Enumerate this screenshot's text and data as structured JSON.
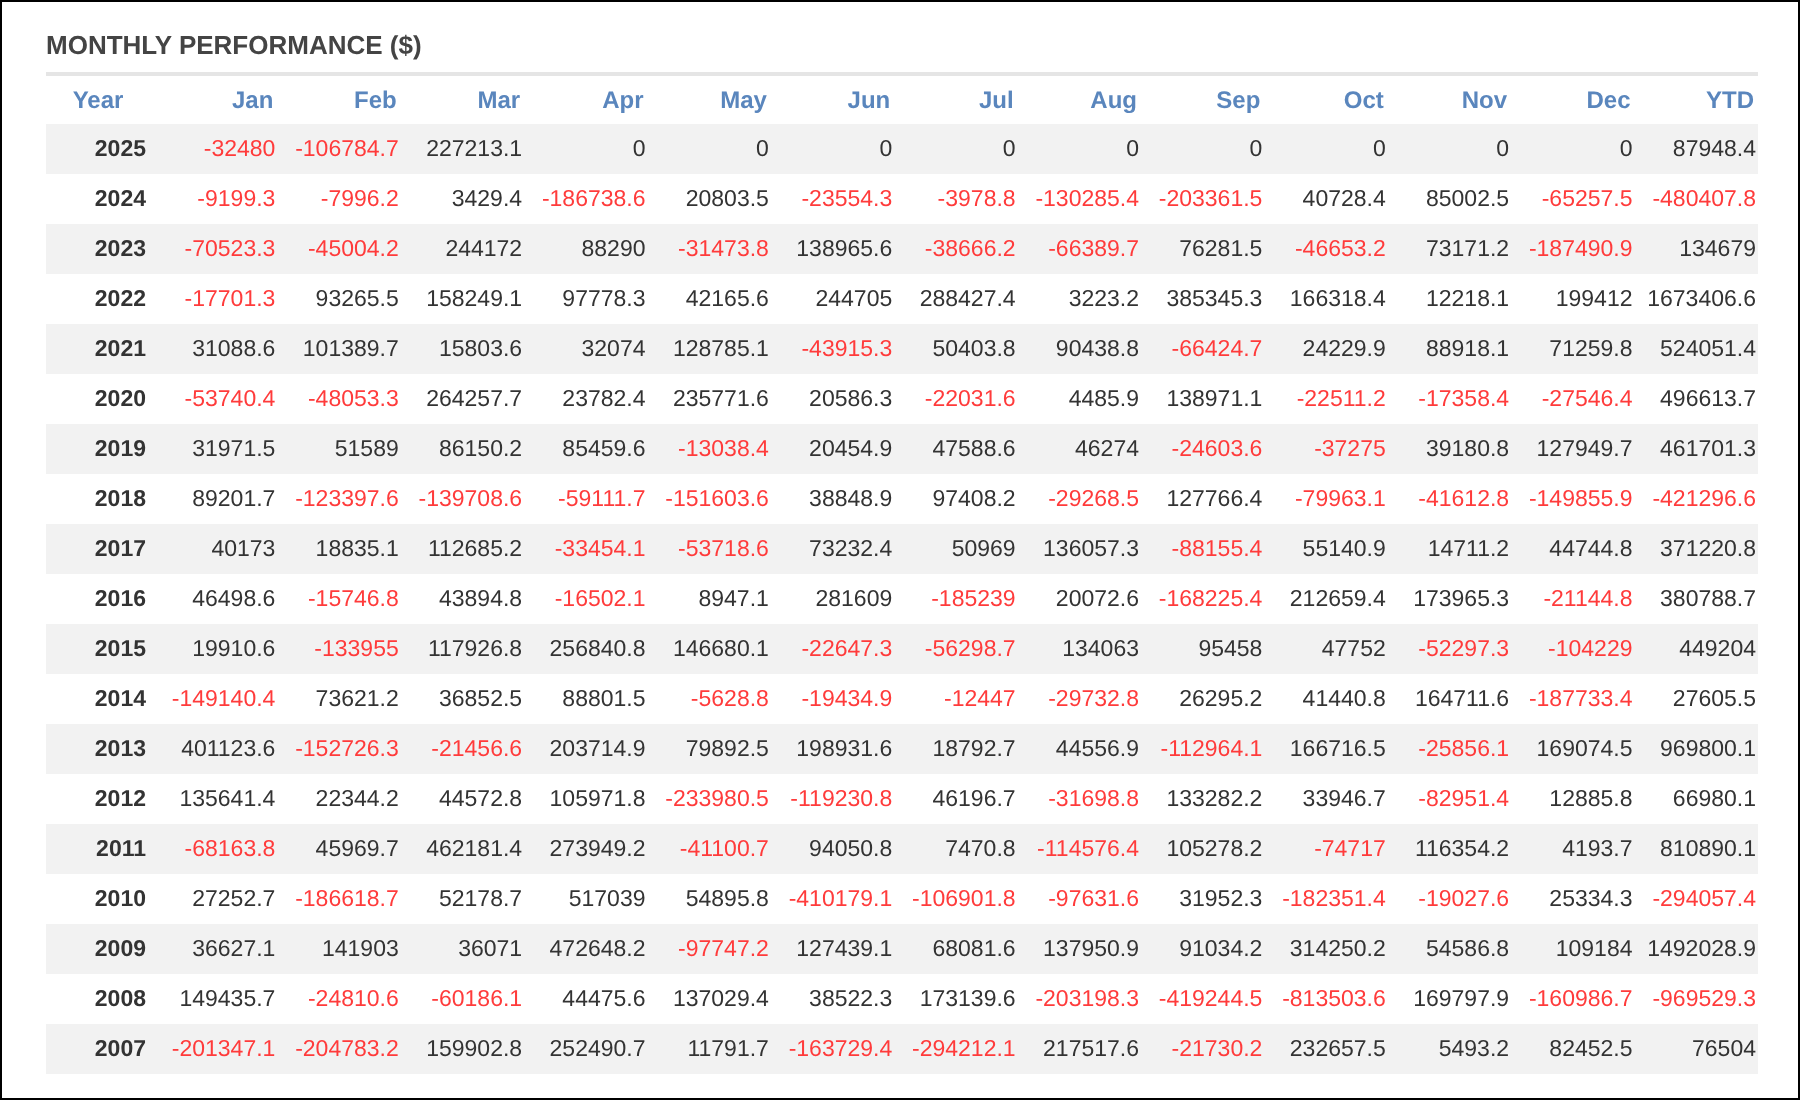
{
  "title": "MONTHLY PERFORMANCE ($)",
  "columns": [
    "Year",
    "Jan",
    "Feb",
    "Mar",
    "Apr",
    "May",
    "Jun",
    "Jul",
    "Aug",
    "Sep",
    "Oct",
    "Nov",
    "Dec",
    "YTD"
  ],
  "rows": [
    {
      "year": "2025",
      "cells": [
        {
          "value": "-32480",
          "negative": true
        },
        {
          "value": "-106784.7",
          "negative": true
        },
        {
          "value": "227213.1",
          "negative": false
        },
        {
          "value": "0",
          "negative": false
        },
        {
          "value": "0",
          "negative": false
        },
        {
          "value": "0",
          "negative": false
        },
        {
          "value": "0",
          "negative": false
        },
        {
          "value": "0",
          "negative": false
        },
        {
          "value": "0",
          "negative": false
        },
        {
          "value": "0",
          "negative": false
        },
        {
          "value": "0",
          "negative": false
        },
        {
          "value": "0",
          "negative": false
        },
        {
          "value": "87948.4",
          "negative": false
        }
      ]
    },
    {
      "year": "2024",
      "cells": [
        {
          "value": "-9199.3",
          "negative": true
        },
        {
          "value": "-7996.2",
          "negative": true
        },
        {
          "value": "3429.4",
          "negative": false
        },
        {
          "value": "-186738.6",
          "negative": true
        },
        {
          "value": "20803.5",
          "negative": false
        },
        {
          "value": "-23554.3",
          "negative": true
        },
        {
          "value": "-3978.8",
          "negative": true
        },
        {
          "value": "-130285.4",
          "negative": true
        },
        {
          "value": "-203361.5",
          "negative": true
        },
        {
          "value": "40728.4",
          "negative": false
        },
        {
          "value": "85002.5",
          "negative": false
        },
        {
          "value": "-65257.5",
          "negative": true
        },
        {
          "value": "-480407.8",
          "negative": true
        }
      ]
    },
    {
      "year": "2023",
      "cells": [
        {
          "value": "-70523.3",
          "negative": true
        },
        {
          "value": "-45004.2",
          "negative": true
        },
        {
          "value": "244172",
          "negative": false
        },
        {
          "value": "88290",
          "negative": false
        },
        {
          "value": "-31473.8",
          "negative": true
        },
        {
          "value": "138965.6",
          "negative": false
        },
        {
          "value": "-38666.2",
          "negative": true
        },
        {
          "value": "-66389.7",
          "negative": true
        },
        {
          "value": "76281.5",
          "negative": false
        },
        {
          "value": "-46653.2",
          "negative": true
        },
        {
          "value": "73171.2",
          "negative": false
        },
        {
          "value": "-187490.9",
          "negative": true
        },
        {
          "value": "134679",
          "negative": false
        }
      ]
    },
    {
      "year": "2022",
      "cells": [
        {
          "value": "-17701.3",
          "negative": true
        },
        {
          "value": "93265.5",
          "negative": false
        },
        {
          "value": "158249.1",
          "negative": false
        },
        {
          "value": "97778.3",
          "negative": false
        },
        {
          "value": "42165.6",
          "negative": false
        },
        {
          "value": "244705",
          "negative": false
        },
        {
          "value": "288427.4",
          "negative": false
        },
        {
          "value": "3223.2",
          "negative": false
        },
        {
          "value": "385345.3",
          "negative": false
        },
        {
          "value": "166318.4",
          "negative": false
        },
        {
          "value": "12218.1",
          "negative": false
        },
        {
          "value": "199412",
          "negative": false
        },
        {
          "value": "1673406.6",
          "negative": false
        }
      ]
    },
    {
      "year": "2021",
      "cells": [
        {
          "value": "31088.6",
          "negative": false
        },
        {
          "value": "101389.7",
          "negative": false
        },
        {
          "value": "15803.6",
          "negative": false
        },
        {
          "value": "32074",
          "negative": false
        },
        {
          "value": "128785.1",
          "negative": false
        },
        {
          "value": "-43915.3",
          "negative": true
        },
        {
          "value": "50403.8",
          "negative": false
        },
        {
          "value": "90438.8",
          "negative": false
        },
        {
          "value": "-66424.7",
          "negative": true
        },
        {
          "value": "24229.9",
          "negative": false
        },
        {
          "value": "88918.1",
          "negative": false
        },
        {
          "value": "71259.8",
          "negative": false
        },
        {
          "value": "524051.4",
          "negative": false
        }
      ]
    },
    {
      "year": "2020",
      "cells": [
        {
          "value": "-53740.4",
          "negative": true
        },
        {
          "value": "-48053.3",
          "negative": true
        },
        {
          "value": "264257.7",
          "negative": false
        },
        {
          "value": "23782.4",
          "negative": false
        },
        {
          "value": "235771.6",
          "negative": false
        },
        {
          "value": "20586.3",
          "negative": false
        },
        {
          "value": "-22031.6",
          "negative": true
        },
        {
          "value": "4485.9",
          "negative": false
        },
        {
          "value": "138971.1",
          "negative": false
        },
        {
          "value": "-22511.2",
          "negative": true
        },
        {
          "value": "-17358.4",
          "negative": true
        },
        {
          "value": "-27546.4",
          "negative": true
        },
        {
          "value": "496613.7",
          "negative": false
        }
      ]
    },
    {
      "year": "2019",
      "cells": [
        {
          "value": "31971.5",
          "negative": false
        },
        {
          "value": "51589",
          "negative": false
        },
        {
          "value": "86150.2",
          "negative": false
        },
        {
          "value": "85459.6",
          "negative": false
        },
        {
          "value": "-13038.4",
          "negative": true
        },
        {
          "value": "20454.9",
          "negative": false
        },
        {
          "value": "47588.6",
          "negative": false
        },
        {
          "value": "46274",
          "negative": false
        },
        {
          "value": "-24603.6",
          "negative": true
        },
        {
          "value": "-37275",
          "negative": true
        },
        {
          "value": "39180.8",
          "negative": false
        },
        {
          "value": "127949.7",
          "negative": false
        },
        {
          "value": "461701.3",
          "negative": false
        }
      ]
    },
    {
      "year": "2018",
      "cells": [
        {
          "value": "89201.7",
          "negative": false
        },
        {
          "value": "-123397.6",
          "negative": true
        },
        {
          "value": "-139708.6",
          "negative": true
        },
        {
          "value": "-59111.7",
          "negative": true
        },
        {
          "value": "-151603.6",
          "negative": true
        },
        {
          "value": "38848.9",
          "negative": false
        },
        {
          "value": "97408.2",
          "negative": false
        },
        {
          "value": "-29268.5",
          "negative": true
        },
        {
          "value": "127766.4",
          "negative": false
        },
        {
          "value": "-79963.1",
          "negative": true
        },
        {
          "value": "-41612.8",
          "negative": true
        },
        {
          "value": "-149855.9",
          "negative": true
        },
        {
          "value": "-421296.6",
          "negative": true
        }
      ]
    },
    {
      "year": "2017",
      "cells": [
        {
          "value": "40173",
          "negative": false
        },
        {
          "value": "18835.1",
          "negative": false
        },
        {
          "value": "112685.2",
          "negative": false
        },
        {
          "value": "-33454.1",
          "negative": true
        },
        {
          "value": "-53718.6",
          "negative": true
        },
        {
          "value": "73232.4",
          "negative": false
        },
        {
          "value": "50969",
          "negative": false
        },
        {
          "value": "136057.3",
          "negative": false
        },
        {
          "value": "-88155.4",
          "negative": true
        },
        {
          "value": "55140.9",
          "negative": false
        },
        {
          "value": "14711.2",
          "negative": false
        },
        {
          "value": "44744.8",
          "negative": false
        },
        {
          "value": "371220.8",
          "negative": false
        }
      ]
    },
    {
      "year": "2016",
      "cells": [
        {
          "value": "46498.6",
          "negative": false
        },
        {
          "value": "-15746.8",
          "negative": true
        },
        {
          "value": "43894.8",
          "negative": false
        },
        {
          "value": "-16502.1",
          "negative": true
        },
        {
          "value": "8947.1",
          "negative": false
        },
        {
          "value": "281609",
          "negative": false
        },
        {
          "value": "-185239",
          "negative": true
        },
        {
          "value": "20072.6",
          "negative": false
        },
        {
          "value": "-168225.4",
          "negative": true
        },
        {
          "value": "212659.4",
          "negative": false
        },
        {
          "value": "173965.3",
          "negative": false
        },
        {
          "value": "-21144.8",
          "negative": true
        },
        {
          "value": "380788.7",
          "negative": false
        }
      ]
    },
    {
      "year": "2015",
      "cells": [
        {
          "value": "19910.6",
          "negative": false
        },
        {
          "value": "-133955",
          "negative": true
        },
        {
          "value": "117926.8",
          "negative": false
        },
        {
          "value": "256840.8",
          "negative": false
        },
        {
          "value": "146680.1",
          "negative": false
        },
        {
          "value": "-22647.3",
          "negative": true
        },
        {
          "value": "-56298.7",
          "negative": true
        },
        {
          "value": "134063",
          "negative": false
        },
        {
          "value": "95458",
          "negative": false
        },
        {
          "value": "47752",
          "negative": false
        },
        {
          "value": "-52297.3",
          "negative": true
        },
        {
          "value": "-104229",
          "negative": true
        },
        {
          "value": "449204",
          "negative": false
        }
      ]
    },
    {
      "year": "2014",
      "cells": [
        {
          "value": "-149140.4",
          "negative": true
        },
        {
          "value": "73621.2",
          "negative": false
        },
        {
          "value": "36852.5",
          "negative": false
        },
        {
          "value": "88801.5",
          "negative": false
        },
        {
          "value": "-5628.8",
          "negative": true
        },
        {
          "value": "-19434.9",
          "negative": true
        },
        {
          "value": "-12447",
          "negative": true
        },
        {
          "value": "-29732.8",
          "negative": true
        },
        {
          "value": "26295.2",
          "negative": false
        },
        {
          "value": "41440.8",
          "negative": false
        },
        {
          "value": "164711.6",
          "negative": false
        },
        {
          "value": "-187733.4",
          "negative": true
        },
        {
          "value": "27605.5",
          "negative": false
        }
      ]
    },
    {
      "year": "2013",
      "cells": [
        {
          "value": "401123.6",
          "negative": false
        },
        {
          "value": "-152726.3",
          "negative": true
        },
        {
          "value": "-21456.6",
          "negative": true
        },
        {
          "value": "203714.9",
          "negative": false
        },
        {
          "value": "79892.5",
          "negative": false
        },
        {
          "value": "198931.6",
          "negative": false
        },
        {
          "value": "18792.7",
          "negative": false
        },
        {
          "value": "44556.9",
          "negative": false
        },
        {
          "value": "-112964.1",
          "negative": true
        },
        {
          "value": "166716.5",
          "negative": false
        },
        {
          "value": "-25856.1",
          "negative": true
        },
        {
          "value": "169074.5",
          "negative": false
        },
        {
          "value": "969800.1",
          "negative": false
        }
      ]
    },
    {
      "year": "2012",
      "cells": [
        {
          "value": "135641.4",
          "negative": false
        },
        {
          "value": "22344.2",
          "negative": false
        },
        {
          "value": "44572.8",
          "negative": false
        },
        {
          "value": "105971.8",
          "negative": false
        },
        {
          "value": "-233980.5",
          "negative": true
        },
        {
          "value": "-119230.8",
          "negative": true
        },
        {
          "value": "46196.7",
          "negative": false
        },
        {
          "value": "-31698.8",
          "negative": true
        },
        {
          "value": "133282.2",
          "negative": false
        },
        {
          "value": "33946.7",
          "negative": false
        },
        {
          "value": "-82951.4",
          "negative": true
        },
        {
          "value": "12885.8",
          "negative": false
        },
        {
          "value": "66980.1",
          "negative": false
        }
      ]
    },
    {
      "year": "2011",
      "cells": [
        {
          "value": "-68163.8",
          "negative": true
        },
        {
          "value": "45969.7",
          "negative": false
        },
        {
          "value": "462181.4",
          "negative": false
        },
        {
          "value": "273949.2",
          "negative": false
        },
        {
          "value": "-41100.7",
          "negative": true
        },
        {
          "value": "94050.8",
          "negative": false
        },
        {
          "value": "7470.8",
          "negative": false
        },
        {
          "value": "-114576.4",
          "negative": true
        },
        {
          "value": "105278.2",
          "negative": false
        },
        {
          "value": "-74717",
          "negative": true
        },
        {
          "value": "116354.2",
          "negative": false
        },
        {
          "value": "4193.7",
          "negative": false
        },
        {
          "value": "810890.1",
          "negative": false
        }
      ]
    },
    {
      "year": "2010",
      "cells": [
        {
          "value": "27252.7",
          "negative": false
        },
        {
          "value": "-186618.7",
          "negative": true
        },
        {
          "value": "52178.7",
          "negative": false
        },
        {
          "value": "517039",
          "negative": false
        },
        {
          "value": "54895.8",
          "negative": false
        },
        {
          "value": "-410179.1",
          "negative": true
        },
        {
          "value": "-106901.8",
          "negative": true
        },
        {
          "value": "-97631.6",
          "negative": true
        },
        {
          "value": "31952.3",
          "negative": false
        },
        {
          "value": "-182351.4",
          "negative": true
        },
        {
          "value": "-19027.6",
          "negative": true
        },
        {
          "value": "25334.3",
          "negative": false
        },
        {
          "value": "-294057.4",
          "negative": true
        }
      ]
    },
    {
      "year": "2009",
      "cells": [
        {
          "value": "36627.1",
          "negative": false
        },
        {
          "value": "141903",
          "negative": false
        },
        {
          "value": "36071",
          "negative": false
        },
        {
          "value": "472648.2",
          "negative": false
        },
        {
          "value": "-97747.2",
          "negative": true
        },
        {
          "value": "127439.1",
          "negative": false
        },
        {
          "value": "68081.6",
          "negative": false
        },
        {
          "value": "137950.9",
          "negative": false
        },
        {
          "value": "91034.2",
          "negative": false
        },
        {
          "value": "314250.2",
          "negative": false
        },
        {
          "value": "54586.8",
          "negative": false
        },
        {
          "value": "109184",
          "negative": false
        },
        {
          "value": "1492028.9",
          "negative": false
        }
      ]
    },
    {
      "year": "2008",
      "cells": [
        {
          "value": "149435.7",
          "negative": false
        },
        {
          "value": "-24810.6",
          "negative": true
        },
        {
          "value": "-60186.1",
          "negative": true
        },
        {
          "value": "44475.6",
          "negative": false
        },
        {
          "value": "137029.4",
          "negative": false
        },
        {
          "value": "38522.3",
          "negative": false
        },
        {
          "value": "173139.6",
          "negative": false
        },
        {
          "value": "-203198.3",
          "negative": true
        },
        {
          "value": "-419244.5",
          "negative": true
        },
        {
          "value": "-813503.6",
          "negative": true
        },
        {
          "value": "169797.9",
          "negative": false
        },
        {
          "value": "-160986.7",
          "negative": true
        },
        {
          "value": "-969529.3",
          "negative": true
        }
      ]
    },
    {
      "year": "2007",
      "cells": [
        {
          "value": "-201347.1",
          "negative": true
        },
        {
          "value": "-204783.2",
          "negative": true
        },
        {
          "value": "159902.8",
          "negative": false
        },
        {
          "value": "252490.7",
          "negative": false
        },
        {
          "value": "11791.7",
          "negative": false
        },
        {
          "value": "-163729.4",
          "negative": true
        },
        {
          "value": "-294212.1",
          "negative": true
        },
        {
          "value": "217517.6",
          "negative": false
        },
        {
          "value": "-21730.2",
          "negative": true
        },
        {
          "value": "232657.5",
          "negative": false
        },
        {
          "value": "5493.2",
          "negative": false
        },
        {
          "value": "82452.5",
          "negative": false
        },
        {
          "value": "76504",
          "negative": false
        }
      ]
    }
  ]
}
